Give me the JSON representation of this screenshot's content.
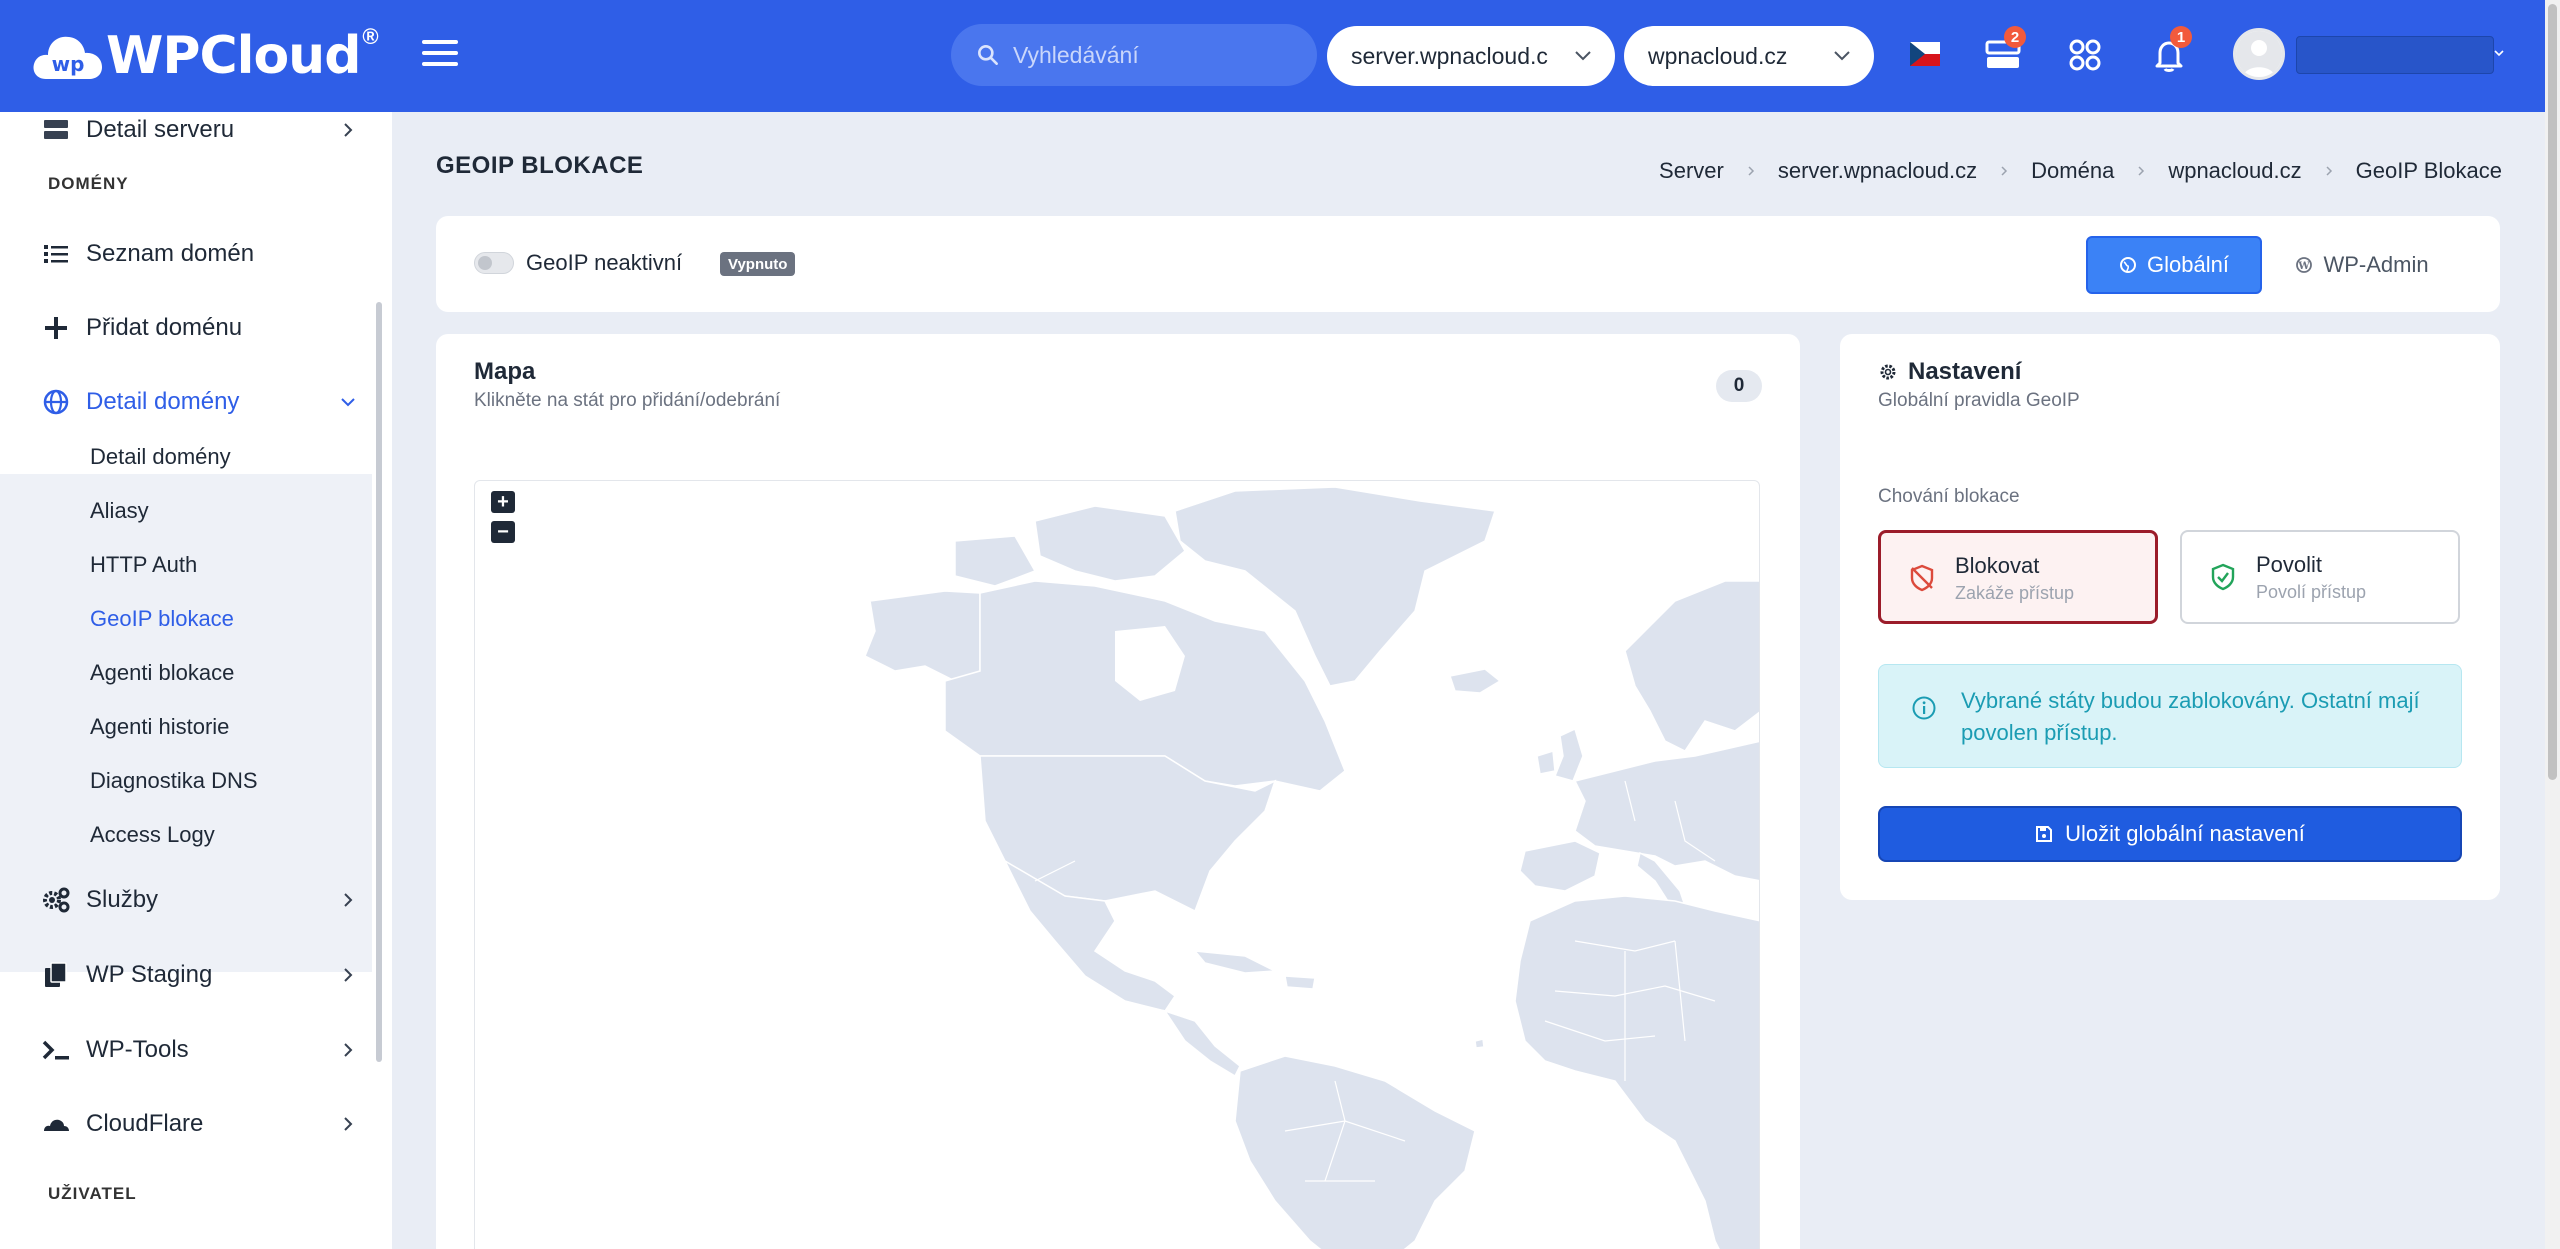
{
  "brand": {
    "name": "WPCloud",
    "mark": "®"
  },
  "header": {
    "search_placeholder": "Vyhledávání",
    "server_select": "server.wpnacloud.c",
    "domain_select": "wpnacloud.cz",
    "servers_badge": "2",
    "notifications_badge": "1",
    "accent_color": "#2f5ee7"
  },
  "sidebar": {
    "detail_serveru": "Detail serveru",
    "section_domeny": "DOMÉNY",
    "seznam_domen": "Seznam domén",
    "pridat_domenu": "Přidat doménu",
    "detail_domeny": "Detail domény",
    "sub": [
      "Detail domény",
      "Aliasy",
      "HTTP Auth",
      "GeoIP blokace",
      "Agenti blokace",
      "Agenti historie",
      "Diagnostika DNS",
      "Access Logy"
    ],
    "sluzby": "Služby",
    "wp_staging": "WP Staging",
    "wp_tools": "WP-Tools",
    "cloudflare": "CloudFlare",
    "section_uzivatel": "UŽIVATEL"
  },
  "page": {
    "title": "GEOIP BLOKACE",
    "breadcrumb": [
      "Server",
      "server.wpnacloud.cz",
      "Doména",
      "wpnacloud.cz",
      "GeoIP Blokace"
    ]
  },
  "toggle": {
    "label": "GeoIP neaktivní",
    "status": "Vypnuto",
    "btn_global": "Globální",
    "btn_wpadmin": "WP-Admin"
  },
  "map": {
    "title": "Mapa",
    "subtitle": "Klikněte na stát pro přidání/odebrání",
    "selected_count": "0",
    "zoom_in": "+",
    "zoom_out": "−",
    "land_color": "#dde3ee"
  },
  "settings": {
    "title": "Nastavení",
    "subtitle": "Globální pravidla GeoIP",
    "behavior_label": "Chování blokace",
    "block_title": "Blokovat",
    "block_sub": "Zakáže přístup",
    "allow_title": "Povolit",
    "allow_sub": "Povolí přístup",
    "info_text": "Vybrané státy budou zablokovány. Ostatní mají povolen přístup.",
    "save_button": "Uložit globální nastavení"
  }
}
